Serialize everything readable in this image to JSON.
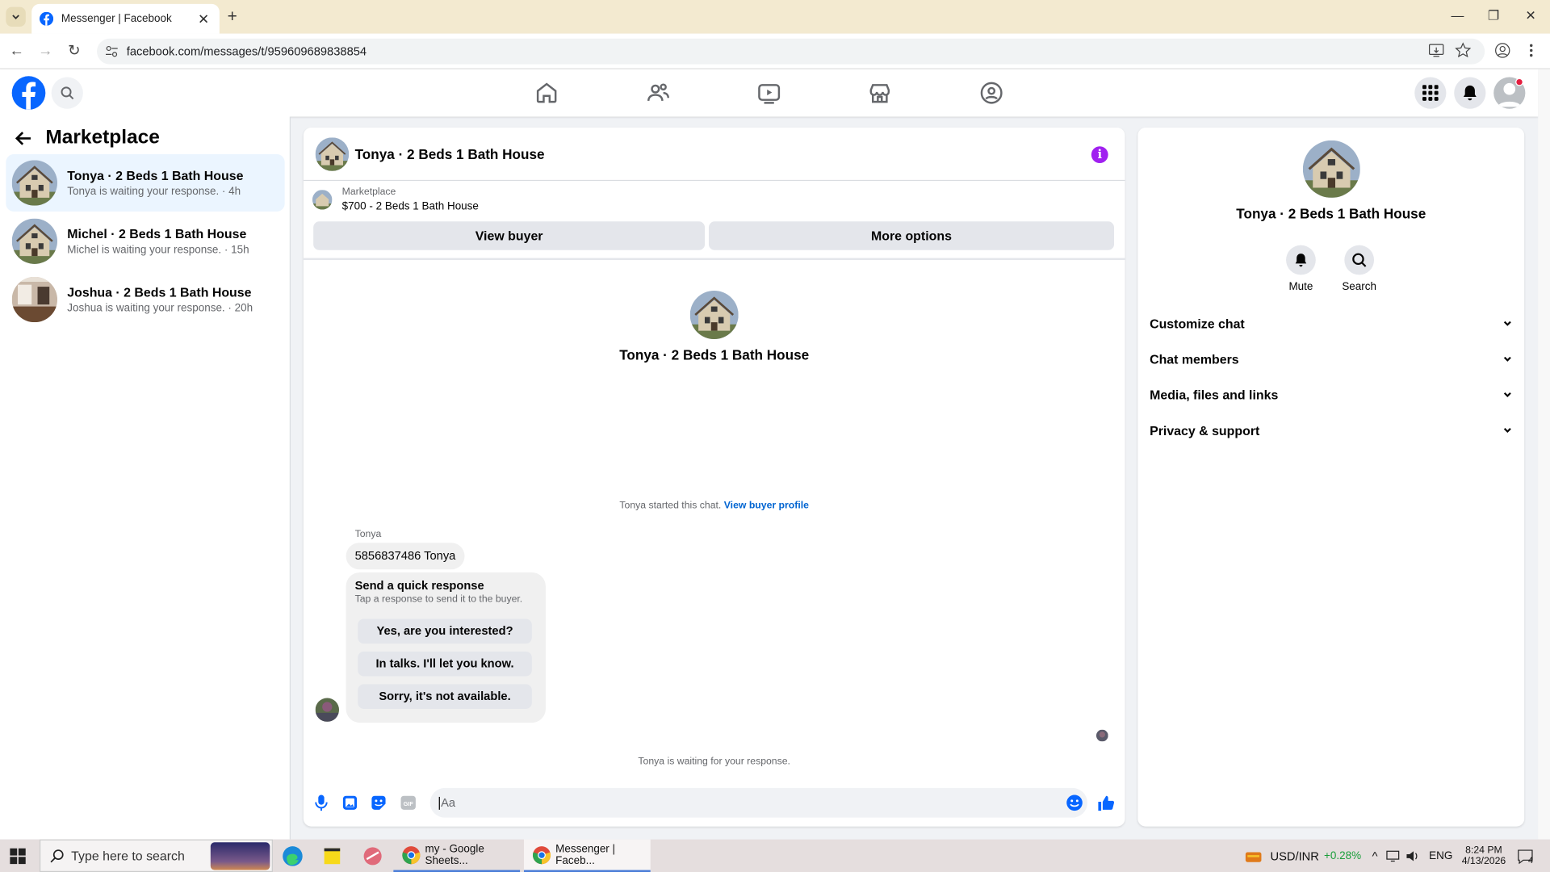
{
  "browser": {
    "tab_title": "Messenger | Facebook",
    "url": "facebook.com/messages/t/959609689838854"
  },
  "sidebar": {
    "title": "Marketplace",
    "conversations": [
      {
        "name": "Tonya · 2 Beds 1 Bath House",
        "sub": "Tonya is waiting your response. · 4h",
        "active": true
      },
      {
        "name": "Michel · 2 Beds 1 Bath House",
        "sub": "Michel is waiting your response. · 15h",
        "active": false
      },
      {
        "name": "Joshua · 2 Beds 1 Bath House",
        "sub": "Joshua is waiting your response. · 20h",
        "active": false
      }
    ]
  },
  "chat": {
    "title": "Tonya · 2 Beds 1 Bath House",
    "marketplace_label": "Marketplace",
    "listing": "$700 - 2 Beds 1 Bath House",
    "view_buyer": "View buyer",
    "more_options": "More options",
    "profile_name": "Tonya · 2 Beds 1 Bath House",
    "started_text": "Tonya started this chat.",
    "view_buyer_profile": "View buyer profile",
    "sender": "Tonya",
    "message": "5856837486 Tonya",
    "quick_title": "Send a quick response",
    "quick_sub": "Tap a response to send it to the buyer.",
    "quick_responses": [
      "Yes, are you interested?",
      "In talks. I'll let you know.",
      "Sorry, it's not available."
    ],
    "waiting_text": "Tonya is waiting for your response.",
    "input_placeholder": "Aa"
  },
  "details": {
    "name": "Tonya · 2 Beds 1 Bath House",
    "mute": "Mute",
    "search": "Search",
    "sections": [
      "Customize chat",
      "Chat members",
      "Media, files and links",
      "Privacy & support"
    ]
  },
  "taskbar": {
    "search_placeholder": "Type here to search",
    "sheets": "my - Google Sheets...",
    "messenger": "Messenger | Faceb...",
    "currency": "USD/INR",
    "change": "+0.28%",
    "lang": "ENG",
    "time": "8:24 PM",
    "date": "4/13/2026",
    "notif_count": "4"
  },
  "colors": {
    "accent": "#0866ff",
    "active_conv": "#ebf5ff",
    "info": "#a020f0",
    "positive": "#1a9e3a"
  }
}
